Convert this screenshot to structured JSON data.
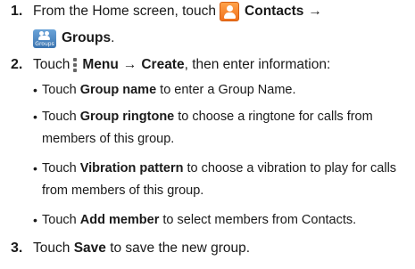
{
  "steps": [
    {
      "number": "1.",
      "line1_prefix": "From the Home screen, touch",
      "contacts_label": "Contacts",
      "arrow": "→",
      "groups_icon_label": "Groups",
      "groups_label": "Groups",
      "groups_suffix": "."
    },
    {
      "number": "2.",
      "touch": "Touch",
      "menu_label": "Menu",
      "arrow": "→",
      "create_label": "Create",
      "suffix": ", then enter information:"
    },
    {
      "number": "3.",
      "touch": "Touch",
      "save_label": "Save",
      "suffix": "to save the new group."
    }
  ],
  "bullets": [
    {
      "touch": "Touch",
      "label": "Group name",
      "text": "to enter a Group Name."
    },
    {
      "touch": "Touch",
      "label": "Group ringtone",
      "text": "to choose a ringtone for calls from",
      "cont": "members of this group."
    },
    {
      "touch": "Touch",
      "label": "Vibration pattern",
      "text": "to choose a vibration to play for calls",
      "cont": "from members of this group."
    },
    {
      "touch": "Touch",
      "label": "Add member",
      "text": "to select members from Contacts."
    }
  ],
  "bullet_char": "•",
  "colors": {
    "contacts_icon": "#f0711d",
    "groups_icon": "#3b74b0",
    "menu_icon": "#666666"
  },
  "icons": {
    "contacts": "contacts-icon",
    "groups": "groups-icon",
    "menu": "menu-icon"
  }
}
